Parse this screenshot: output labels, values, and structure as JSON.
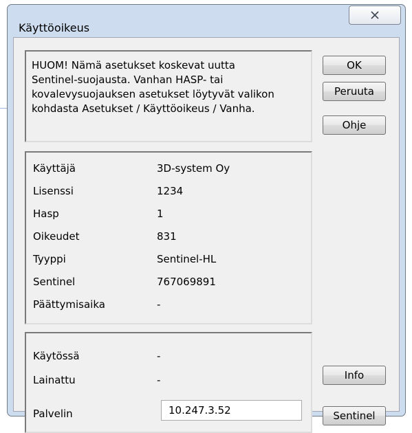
{
  "window": {
    "title": "Käyttöoikeus"
  },
  "notice": {
    "text": "HUOM! Nämä asetukset koskevat uutta\nSentinel-suojausta. Vanhan HASP- tai\nkovalevysuojauksen asetukset löytyvät valikon\nkohdasta Asetukset / Käyttöoikeus / Vanha."
  },
  "buttons": {
    "ok": "OK",
    "cancel": "Peruuta",
    "help": "Ohje",
    "info": "Info",
    "sentinel": "Sentinel"
  },
  "license_info": [
    {
      "label": "Käyttäjä",
      "value": "3D-system Oy"
    },
    {
      "label": "Lisenssi",
      "value": "1234"
    },
    {
      "label": "Hasp",
      "value": "1"
    },
    {
      "label": "Oikeudet",
      "value": "831"
    },
    {
      "label": "Tyyppi",
      "value": "Sentinel-HL"
    },
    {
      "label": "Sentinel",
      "value": "767069891"
    },
    {
      "label": "Päättymisaika",
      "value": "-"
    }
  ],
  "status": {
    "in_use_label": "Käytössä",
    "in_use_value": "-",
    "loaned_label": "Lainattu",
    "loaned_value": "-",
    "server_label": "Palvelin",
    "server_value": "10.247.3.52"
  },
  "icons": {
    "close": "close-x-icon"
  }
}
